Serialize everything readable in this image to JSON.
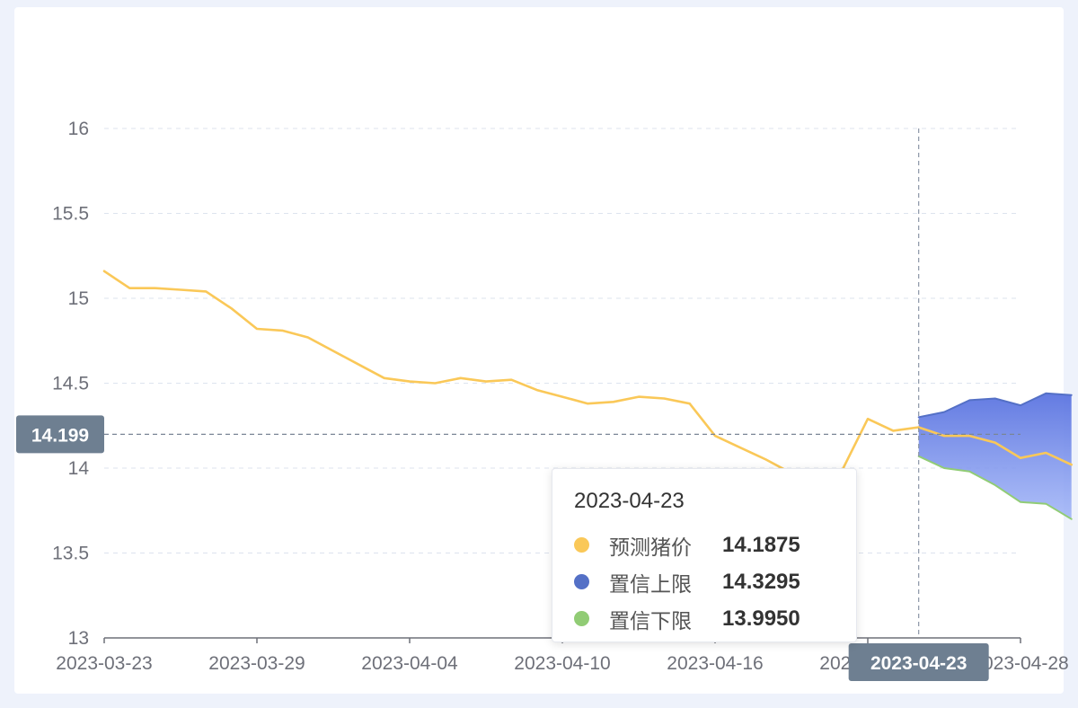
{
  "chart_data": {
    "type": "line",
    "title": "",
    "xlabel": "",
    "ylabel": "",
    "ylim": [
      13,
      16
    ],
    "y_ticks": [
      "16",
      "15.5",
      "15",
      "14.5",
      "14",
      "13.5",
      "13"
    ],
    "x_tick_labels": [
      "2023-03-23",
      "2023-03-29",
      "2023-04-04",
      "2023-04-10",
      "2023-04-16",
      "2023-04-22",
      "2023-04-28"
    ],
    "x_start": "2023-03-23",
    "x_end": "2023-04-28",
    "grid": true,
    "legend": "none",
    "series": [
      {
        "name": "预测猪价",
        "color": "#fac858",
        "points": [
          [
            "2023-03-23",
            15.16
          ],
          [
            "2023-03-24",
            15.06
          ],
          [
            "2023-03-25",
            15.06
          ],
          [
            "2023-03-26",
            15.05
          ],
          [
            "2023-03-27",
            15.04
          ],
          [
            "2023-03-28",
            14.94
          ],
          [
            "2023-03-29",
            14.82
          ],
          [
            "2023-03-30",
            14.81
          ],
          [
            "2023-03-31",
            14.77
          ],
          [
            "2023-04-01",
            14.69
          ],
          [
            "2023-04-02",
            14.61
          ],
          [
            "2023-04-03",
            14.53
          ],
          [
            "2023-04-04",
            14.51
          ],
          [
            "2023-04-05",
            14.5
          ],
          [
            "2023-04-06",
            14.53
          ],
          [
            "2023-04-07",
            14.51
          ],
          [
            "2023-04-08",
            14.52
          ],
          [
            "2023-04-09",
            14.46
          ],
          [
            "2023-04-10",
            14.42
          ],
          [
            "2023-04-11",
            14.38
          ],
          [
            "2023-04-12",
            14.39
          ],
          [
            "2023-04-13",
            14.42
          ],
          [
            "2023-04-14",
            14.41
          ],
          [
            "2023-04-15",
            14.38
          ],
          [
            "2023-04-16",
            14.19
          ],
          [
            "2023-04-17",
            14.12
          ],
          [
            "2023-04-18",
            14.05
          ],
          [
            "2023-04-19",
            13.97
          ],
          [
            "2023-04-20",
            13.94
          ],
          [
            "2023-04-21",
            13.99
          ],
          [
            "2023-04-22",
            14.29
          ],
          [
            "2023-04-23",
            14.22
          ],
          [
            "2023-04-24",
            14.24
          ],
          [
            "2023-04-25",
            14.19
          ],
          [
            "2023-04-26",
            14.19
          ],
          [
            "2023-04-27",
            14.15
          ],
          [
            "2023-04-28",
            14.06
          ],
          [
            "2023-04-29",
            14.09
          ],
          [
            "2023-04-30",
            14.02
          ]
        ]
      },
      {
        "name": "置信上限",
        "color": "#5470c6",
        "points": [
          [
            "2023-04-24",
            14.3
          ],
          [
            "2023-04-25",
            14.33
          ],
          [
            "2023-04-26",
            14.4
          ],
          [
            "2023-04-27",
            14.41
          ],
          [
            "2023-04-28",
            14.37
          ],
          [
            "2023-04-29",
            14.44
          ],
          [
            "2023-04-30",
            14.43
          ]
        ]
      },
      {
        "name": "置信下限",
        "color": "#91cc75",
        "points": [
          [
            "2023-04-24",
            14.07
          ],
          [
            "2023-04-25",
            14.0
          ],
          [
            "2023-04-26",
            13.98
          ],
          [
            "2023-04-27",
            13.9
          ],
          [
            "2023-04-28",
            13.8
          ],
          [
            "2023-04-29",
            13.79
          ],
          [
            "2023-04-30",
            13.7
          ]
        ]
      }
    ],
    "crosshair": {
      "x": "2023-04-23",
      "x_label": "2023-04-23",
      "y": 14.199,
      "y_label": "14.199"
    },
    "tooltip": {
      "title": "2023-04-23",
      "rows": [
        {
          "name": "预测猪价",
          "value": "14.1875",
          "color": "#fac858"
        },
        {
          "name": "置信上限",
          "value": "14.3295",
          "color": "#5470c6"
        },
        {
          "name": "置信下限",
          "value": "13.9950",
          "color": "#91cc75"
        }
      ]
    }
  }
}
